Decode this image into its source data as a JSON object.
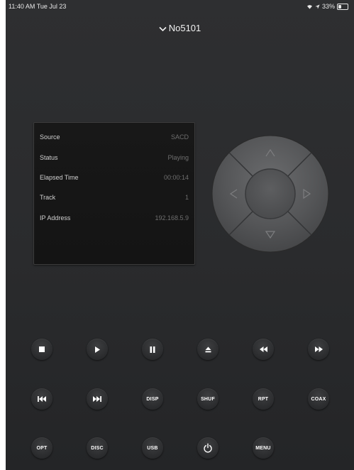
{
  "status_bar": {
    "time": "11:40 AM  Tue Jul 23",
    "battery": "33%"
  },
  "header": {
    "title": "No5101"
  },
  "info": {
    "rows": [
      {
        "label": "Source",
        "value": "SACD"
      },
      {
        "label": "Status",
        "value": "Playing"
      },
      {
        "label": "Elapsed Time",
        "value": "00:00:14"
      },
      {
        "label": "Track",
        "value": "1"
      },
      {
        "label": "IP Address",
        "value": "192.168.5.9"
      }
    ]
  },
  "buttons": {
    "disp": "DISP",
    "shuf": "SHUF",
    "rpt": "RPT",
    "coax": "COAX",
    "opt": "OPT",
    "disc": "DISC",
    "usb": "USB",
    "menu": "MENU"
  },
  "icons": {
    "transport": [
      "stop-icon",
      "play-icon",
      "pause-icon",
      "eject-icon",
      "rewind-icon",
      "fast-forward-icon",
      "skip-previous-icon",
      "skip-next-icon",
      "power-icon"
    ],
    "dpad": [
      "arrow-up-icon",
      "arrow-right-icon",
      "arrow-down-icon",
      "arrow-left-icon"
    ]
  }
}
